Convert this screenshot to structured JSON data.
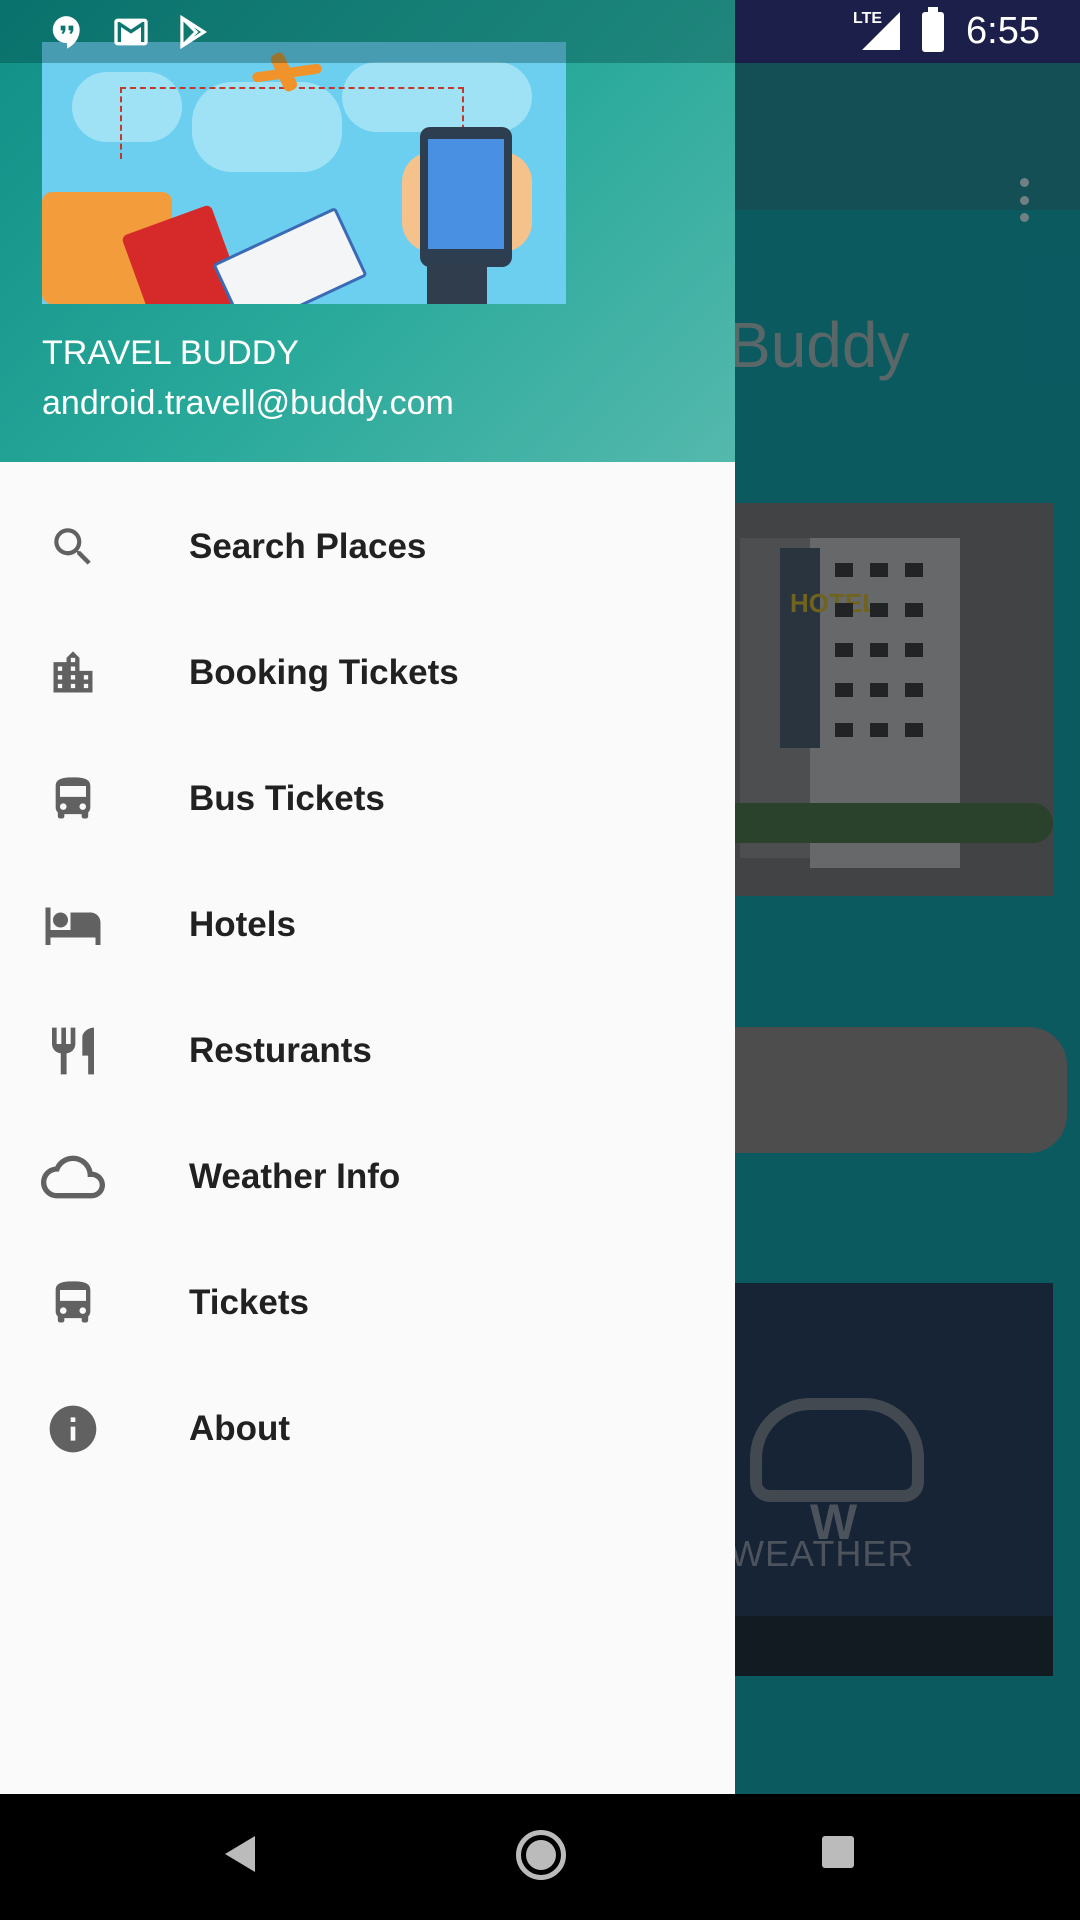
{
  "status_bar": {
    "time": "6:55",
    "network": "LTE",
    "notification_icons": [
      "hangouts-icon",
      "gmail-icon",
      "play-store-icon"
    ]
  },
  "background": {
    "title_fragment": "Buddy",
    "weather_card_text": "WEATHER",
    "weather_card_letter": "W",
    "hotel_sign": "HOTEL"
  },
  "drawer": {
    "app_name": "TRAVEL BUDDY",
    "email": "android.travell@buddy.com",
    "items": [
      {
        "label": "Search Places",
        "icon": "search-icon"
      },
      {
        "label": "Booking Tickets",
        "icon": "city-icon"
      },
      {
        "label": "Bus Tickets",
        "icon": "bus-icon"
      },
      {
        "label": "Hotels",
        "icon": "hotel-bed-icon"
      },
      {
        "label": "Resturants",
        "icon": "restaurant-icon"
      },
      {
        "label": "Weather Info",
        "icon": "cloud-icon"
      },
      {
        "label": "Tickets",
        "icon": "bus-icon"
      },
      {
        "label": "About",
        "icon": "info-icon"
      }
    ]
  },
  "colors": {
    "drawer_header_start": "#0f8f86",
    "drawer_header_end": "#55b8ad",
    "drawer_bg": "#fafafa",
    "icon_gray": "#616161",
    "label_text": "#212121"
  }
}
